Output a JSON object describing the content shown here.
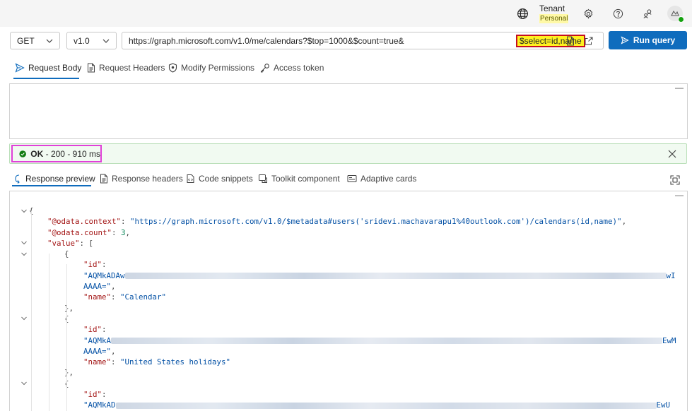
{
  "header": {
    "tenant_label": "Tenant",
    "tenant_sub": "Personal",
    "icons": [
      "globe-icon",
      "settings-icon",
      "help-icon",
      "feedback-icon",
      "avatar"
    ]
  },
  "query": {
    "method": "GET",
    "version": "v1.0",
    "url_prefix": "https://graph.microsoft.com/v1.0/me/calendars?$top=1000&$count=true&",
    "url_highlight": "$select=id,name",
    "run_label": "Run query"
  },
  "request_tabs": [
    {
      "label": "Request Body",
      "icon": "send-icon",
      "active": true
    },
    {
      "label": "Request Headers",
      "icon": "document-icon",
      "active": false
    },
    {
      "label": "Modify Permissions",
      "icon": "shield-icon",
      "active": false
    },
    {
      "label": "Access token",
      "icon": "key-icon",
      "active": false
    }
  ],
  "status": {
    "ok": "OK",
    "detail": " - 200 - 910 ms"
  },
  "response_tabs": [
    {
      "label": "Response preview",
      "icon": "preview-icon",
      "active": true
    },
    {
      "label": "Response headers",
      "icon": "document-icon",
      "active": false
    },
    {
      "label": "Code snippets",
      "icon": "code-icon",
      "active": false
    },
    {
      "label": "Toolkit component",
      "icon": "toolkit-icon",
      "active": false
    },
    {
      "label": "Adaptive cards",
      "icon": "card-icon",
      "active": false
    }
  ],
  "response": {
    "open_brace": "{",
    "context_key": "\"@odata.context\"",
    "context_val": "\"https://graph.microsoft.com/v1.0/$metadata#users('sridevi.machavarapu1%40outlook.com')/calendars(id,name)\"",
    "count_key": "\"@odata.count\"",
    "count_val": "3",
    "value_key": "\"value\"",
    "items": [
      {
        "id_key": "\"id\"",
        "id_start": "\"AQMkADAw",
        "id_end": "wI",
        "id_cont": "AAAA=\"",
        "name_key": "\"name\"",
        "name_val": "\"Calendar\""
      },
      {
        "id_key": "\"id\"",
        "id_start": "\"AQMkA",
        "id_end": "EwM",
        "id_cont": "AAAA=\"",
        "name_key": "\"name\"",
        "name_val": "\"United States holidays\""
      },
      {
        "id_key": "\"id\"",
        "id_start": "\"AQMkAD",
        "id_end": "EwU"
      }
    ]
  }
}
